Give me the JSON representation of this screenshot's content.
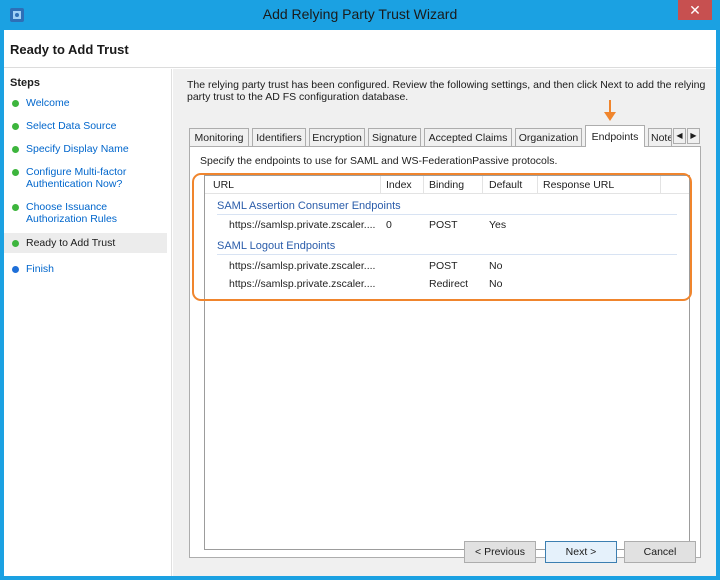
{
  "window": {
    "title": "Add Relying Party Trust Wizard",
    "close_label": "✕"
  },
  "header": {
    "title": "Ready to Add Trust"
  },
  "steps": {
    "title": "Steps",
    "items": [
      {
        "label": "Welcome",
        "state": "done"
      },
      {
        "label": "Select Data Source",
        "state": "done"
      },
      {
        "label": "Specify Display Name",
        "state": "done"
      },
      {
        "label": "Configure Multi-factor Authentication Now?",
        "state": "done"
      },
      {
        "label": "Choose Issuance Authorization Rules",
        "state": "done"
      },
      {
        "label": "Ready to Add Trust",
        "state": "current"
      },
      {
        "label": "Finish",
        "state": "pending"
      }
    ]
  },
  "intro": "The relying party trust has been configured. Review the following settings, and then click Next to add the relying party trust to the AD FS configuration database.",
  "tabs": [
    {
      "label": "Monitoring"
    },
    {
      "label": "Identifiers"
    },
    {
      "label": "Encryption"
    },
    {
      "label": "Signature"
    },
    {
      "label": "Accepted Claims"
    },
    {
      "label": "Organization"
    },
    {
      "label": "Endpoints",
      "active": true
    },
    {
      "label": "Note"
    }
  ],
  "tab_scroll": {
    "left": "◀",
    "right": "▶"
  },
  "endpoints": {
    "description": "Specify the endpoints to use for SAML and WS-FederationPassive protocols.",
    "columns": [
      "URL",
      "Index",
      "Binding",
      "Default",
      "Response URL"
    ],
    "groups": [
      {
        "name": "SAML Assertion Consumer Endpoints",
        "rows": [
          {
            "url": "https://samlsp.private.zscaler....",
            "index": "0",
            "binding": "POST",
            "default": "Yes",
            "response_url": ""
          }
        ]
      },
      {
        "name": "SAML Logout Endpoints",
        "rows": [
          {
            "url": "https://samlsp.private.zscaler....",
            "index": "",
            "binding": "POST",
            "default": "No",
            "response_url": ""
          },
          {
            "url": "https://samlsp.private.zscaler....",
            "index": "",
            "binding": "Redirect",
            "default": "No",
            "response_url": ""
          }
        ]
      }
    ]
  },
  "buttons": {
    "previous": "< Previous",
    "next": "Next >",
    "cancel": "Cancel"
  },
  "colors": {
    "titlebar": "#1ba1e2",
    "highlight": "#f0852d",
    "step_done": "#3db53d",
    "step_pending": "#1e6fd8",
    "link": "#0066cc",
    "group": "#2a5caa"
  }
}
